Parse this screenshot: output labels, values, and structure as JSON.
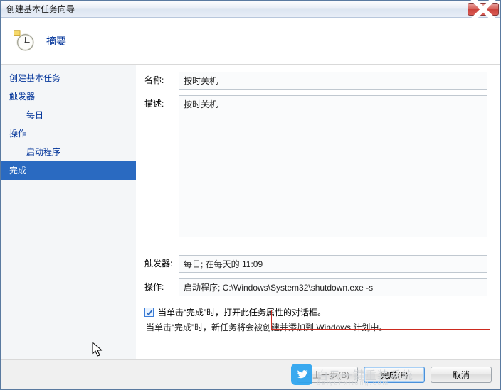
{
  "window": {
    "title": "创建基本任务向导"
  },
  "header": {
    "title": "摘要"
  },
  "sidebar": {
    "items": [
      {
        "label": "创建基本任务",
        "sub": false,
        "sel": false
      },
      {
        "label": "触发器",
        "sub": false,
        "sel": false
      },
      {
        "label": "每日",
        "sub": true,
        "sel": false
      },
      {
        "label": "操作",
        "sub": false,
        "sel": false
      },
      {
        "label": "启动程序",
        "sub": true,
        "sel": false
      },
      {
        "label": "完成",
        "sub": false,
        "sel": true
      }
    ]
  },
  "form": {
    "name_label": "名称:",
    "name_value": "按时关机",
    "desc_label": "描述:",
    "desc_value": "按时关机",
    "trigger_label": "触发器:",
    "trigger_value": "每日; 在每天的 11:09",
    "action_label": "操作:",
    "action_value": "启动程序; C:\\Windows\\System32\\shutdown.exe -s",
    "checkbox_label": "当单击“完成”时，打开此任务属性的对话框。",
    "hint": "当单击“完成”时，新任务将会被创建并添加到 Windows 计划中。"
  },
  "footer": {
    "back": "< 上一步(B)",
    "finish": "完成(F)",
    "cancel": "取消"
  },
  "watermark": {
    "text": "白云一键重装系统",
    "sub": "baiyunxitong.com"
  }
}
